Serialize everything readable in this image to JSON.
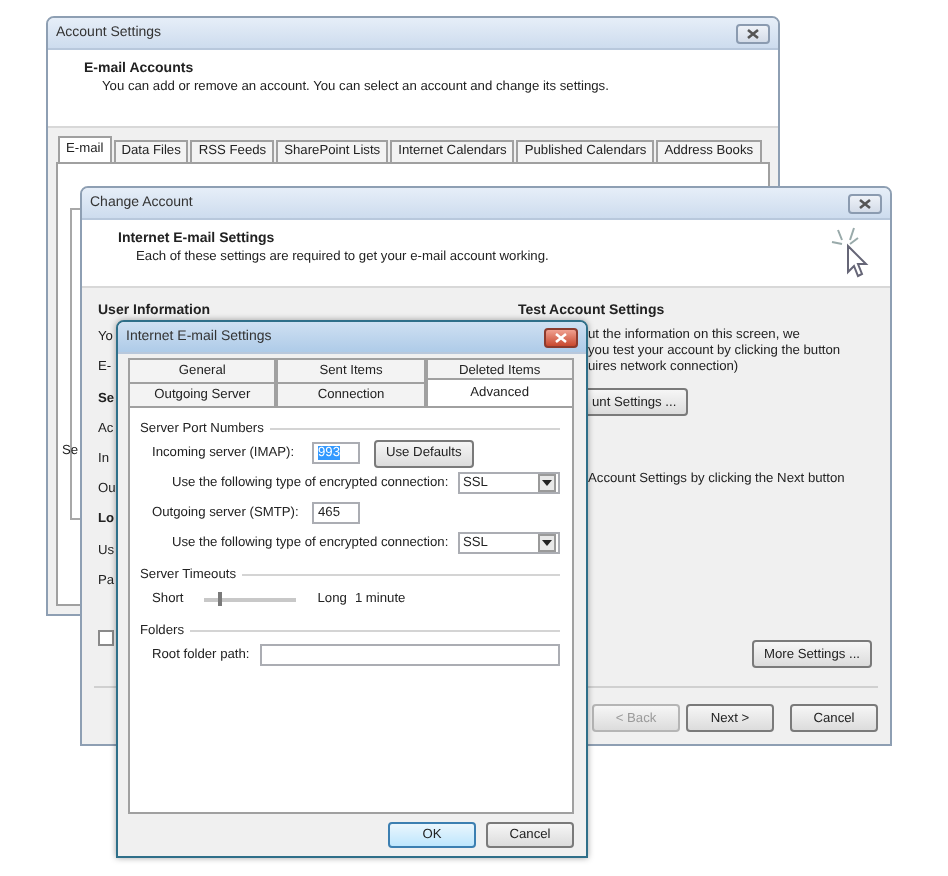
{
  "account_settings": {
    "title": "Account Settings",
    "header_title": "E-mail Accounts",
    "header_text": "You can add or remove an account. You can select an account and change its settings.",
    "tabs": [
      {
        "label": "E-mail",
        "selected": true
      },
      {
        "label": "Data Files",
        "selected": false
      },
      {
        "label": "RSS Feeds",
        "selected": false
      },
      {
        "label": "SharePoint Lists",
        "selected": false
      },
      {
        "label": "Internet Calendars",
        "selected": false
      },
      {
        "label": "Published Calendars",
        "selected": false
      },
      {
        "label": "Address Books",
        "selected": false
      }
    ],
    "fragment": "Se"
  },
  "change_account": {
    "title": "Change Account",
    "header_title": "Internet E-mail Settings",
    "header_text": "Each of these settings are required to get your e-mail account working.",
    "user_information": {
      "heading": "User Information",
      "lines": [
        {
          "text": "Yo",
          "kind": "label"
        },
        {
          "text": "E-",
          "kind": "label"
        },
        {
          "text": "Se",
          "kind": "heading"
        },
        {
          "text": "Ac",
          "kind": "label"
        },
        {
          "text": "In",
          "kind": "label"
        },
        {
          "text": "Ou",
          "kind": "label"
        },
        {
          "text": "Lo",
          "kind": "heading"
        },
        {
          "text": "Us",
          "kind": "label"
        },
        {
          "text": "Pa",
          "kind": "label"
        }
      ]
    },
    "test_settings": {
      "heading": "Test Account Settings",
      "lines": [
        "ut the information on this screen, we",
        "you test your account by clicking the button",
        "uires network connection)"
      ],
      "button": "unt Settings ...",
      "note": "Account Settings by clicking the Next button"
    },
    "checkbox": {
      "checked": false
    },
    "more_button": "More Settings ...",
    "buttons": [
      {
        "label": "< Back",
        "disabled": true
      },
      {
        "label": "Next >",
        "disabled": false
      },
      {
        "label": "Cancel",
        "disabled": false
      }
    ]
  },
  "email_settings": {
    "title": "Internet E-mail Settings",
    "tab_rows": [
      [
        {
          "label": "General",
          "selected": false
        },
        {
          "label": "Sent Items",
          "selected": false
        },
        {
          "label": "Deleted Items",
          "selected": false
        }
      ],
      [
        {
          "label": "Outgoing Server",
          "selected": false
        },
        {
          "label": "Connection",
          "selected": false
        },
        {
          "label": "Advanced",
          "selected": true
        }
      ]
    ],
    "sections": [
      {
        "heading": "Server Port Numbers",
        "rows": [
          {
            "kind": "port",
            "label": "Incoming server (IMAP):",
            "value": "993",
            "highlighted": true,
            "button": "Use Defaults"
          },
          {
            "kind": "encryption",
            "label": "Use the following type of encrypted connection:",
            "value": "SSL"
          },
          {
            "kind": "port",
            "label": "Outgoing server (SMTP):",
            "value": "465",
            "highlighted": false
          },
          {
            "kind": "encryption",
            "label": "Use the following type of encrypted connection:",
            "value": "SSL"
          }
        ]
      },
      {
        "heading": "Server Timeouts",
        "rows": [
          {
            "kind": "timeout",
            "min_label": "Short",
            "max_label": "Long",
            "level": 0.15,
            "reading": "1 minute"
          }
        ]
      },
      {
        "heading": "Folders",
        "rows": [
          {
            "kind": "path",
            "label": "Root folder path:"
          }
        ]
      }
    ],
    "buttons": [
      {
        "label": "OK",
        "default": true
      },
      {
        "label": "Cancel",
        "default": false
      }
    ]
  }
}
